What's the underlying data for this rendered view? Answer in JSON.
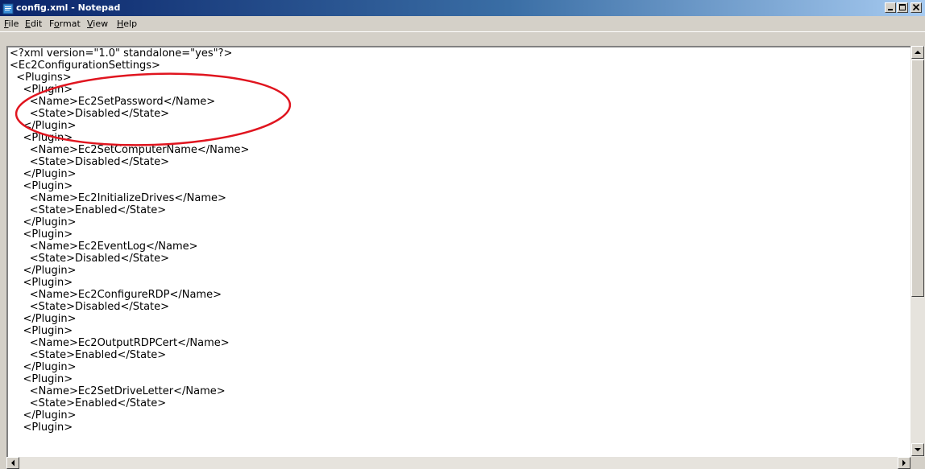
{
  "window": {
    "title": "config.xml - Notepad",
    "icon": "notepad-icon"
  },
  "menu": {
    "items": [
      {
        "label": "File"
      },
      {
        "label": "Edit"
      },
      {
        "label": "Format"
      },
      {
        "label": "View"
      },
      {
        "label": "Help"
      }
    ]
  },
  "editor": {
    "lines": [
      "<?xml version=\"1.0\" standalone=\"yes\"?>",
      "<Ec2ConfigurationSettings>",
      "  <Plugins>",
      "    <Plugin>",
      "      <Name>Ec2SetPassword</Name>",
      "      <State>Disabled</State>",
      "    </Plugin>",
      "    <Plugin>",
      "      <Name>Ec2SetComputerName</Name>",
      "      <State>Disabled</State>",
      "    </Plugin>",
      "    <Plugin>",
      "      <Name>Ec2InitializeDrives</Name>",
      "      <State>Enabled</State>",
      "    </Plugin>",
      "    <Plugin>",
      "      <Name>Ec2EventLog</Name>",
      "      <State>Disabled</State>",
      "    </Plugin>",
      "    <Plugin>",
      "      <Name>Ec2ConfigureRDP</Name>",
      "      <State>Disabled</State>",
      "    </Plugin>",
      "    <Plugin>",
      "      <Name>Ec2OutputRDPCert</Name>",
      "      <State>Enabled</State>",
      "    </Plugin>",
      "    <Plugin>",
      "      <Name>Ec2SetDriveLetter</Name>",
      "      <State>Enabled</State>",
      "    </Plugin>",
      "    <Plugin>"
    ]
  },
  "annotation": {
    "shape": "ellipse",
    "color": "#e0151f"
  },
  "colors": {
    "titlebar_start": "#0a246a",
    "titlebar_end": "#a6caf0",
    "chrome": "#d4d0c8"
  }
}
